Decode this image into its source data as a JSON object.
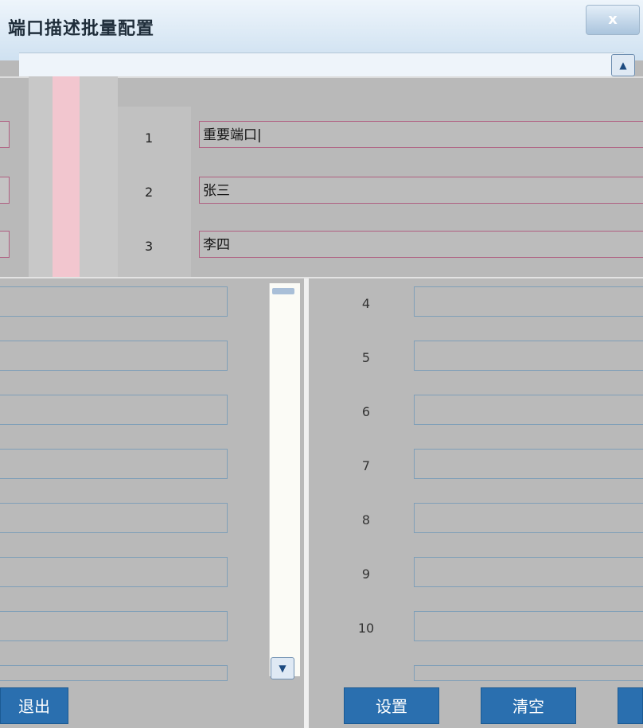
{
  "dialog": {
    "title": "端口描述批量配置",
    "close_label": "x"
  },
  "scroll_up_label": "▲",
  "scroll_down_label": "▼",
  "top_rows": [
    {
      "num": "1",
      "value": "重要端口|"
    },
    {
      "num": "2",
      "value": "张三"
    },
    {
      "num": "3",
      "value": "李四"
    }
  ],
  "right_rows": [
    "4",
    "5",
    "6",
    "7",
    "8",
    "9",
    "10"
  ],
  "buttons": {
    "exit": "退出",
    "set": "设置",
    "clear": "清空"
  }
}
